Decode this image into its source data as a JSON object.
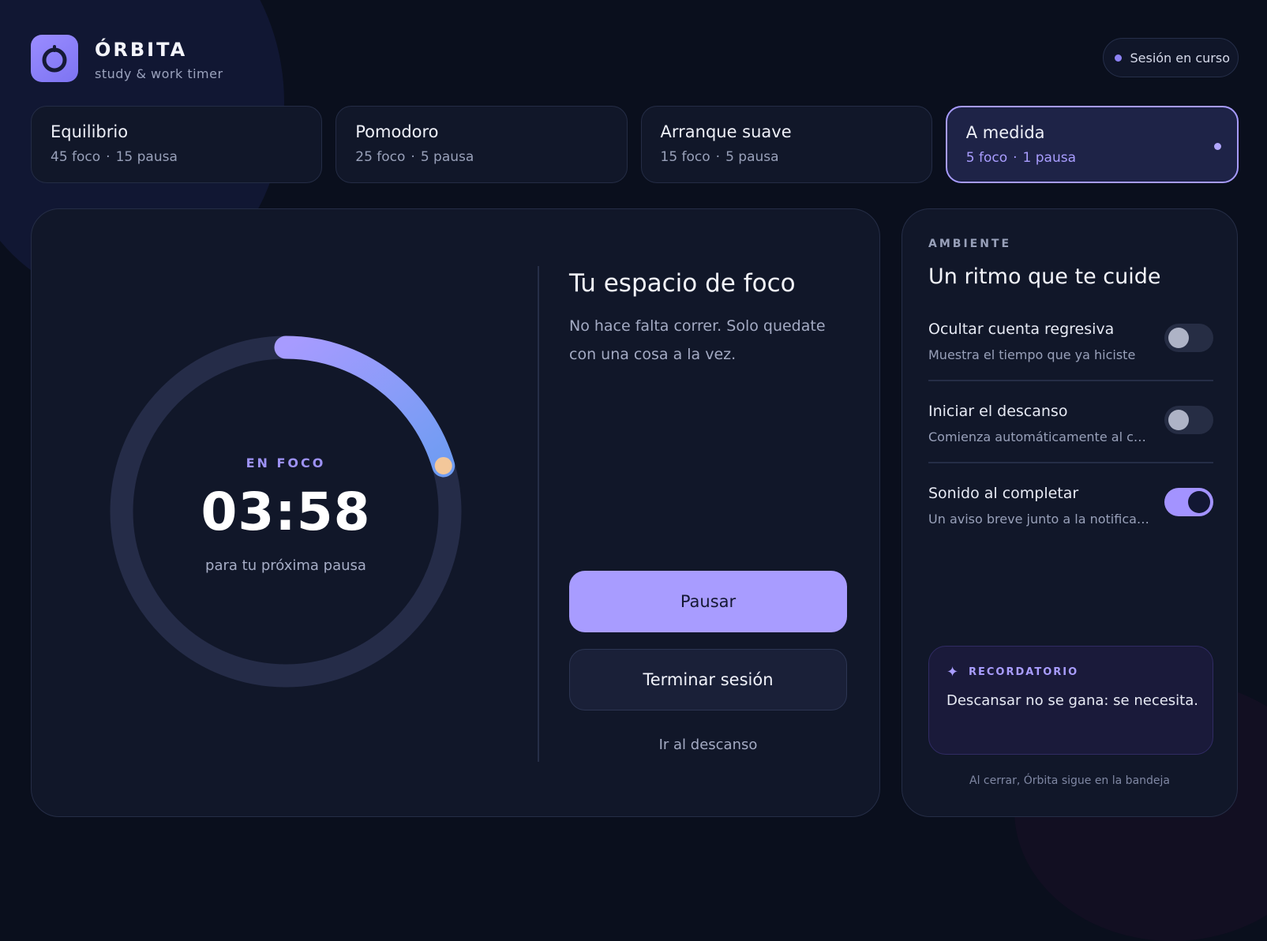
{
  "app": {
    "name": "ÓRBITA",
    "tagline": "study & work timer",
    "status": "Sesión en curso"
  },
  "presets": [
    {
      "name": "Equilibrio",
      "focus": "45 foco",
      "pause": "15 pausa",
      "separator": "·",
      "active": false
    },
    {
      "name": "Pomodoro",
      "focus": "25 foco",
      "pause": "5 pausa",
      "separator": "·",
      "active": false
    },
    {
      "name": "Arranque suave",
      "focus": "15 foco",
      "pause": "5 pausa",
      "separator": "·",
      "active": false
    },
    {
      "name": "A medida",
      "focus": "5 foco",
      "pause": "1 pausa",
      "separator": "·",
      "active": true
    }
  ],
  "timer": {
    "state_label": "EN FOCO",
    "time": "03:58",
    "caption": "para tu próxima pausa",
    "elapsed_fraction": 0.205
  },
  "focus_panel": {
    "title": "Tu espacio de foco",
    "description": "No hace falta correr. Solo quedate con una cosa a la vez.",
    "primary_button": "Pausar",
    "secondary_button": "Terminar sesión",
    "link": "Ir al descanso"
  },
  "sidebar": {
    "eyebrow": "AMBIENTE",
    "title": "Un ritmo que te cuide",
    "settings": [
      {
        "title": "Ocultar cuenta regresiva",
        "description": "Muestra el tiempo que ya hiciste",
        "enabled": false
      },
      {
        "title": "Iniciar el descanso",
        "description": "Comienza automáticamente al co...",
        "enabled": false
      },
      {
        "title": "Sonido al completar",
        "description": "Un aviso breve junto a la notificaci...",
        "enabled": true
      }
    ],
    "reminder": {
      "icon": "sparkle-icon",
      "label": "RECORDATORIO",
      "text": "Descansar no se gana: se necesita."
    },
    "footer": "Al cerrar, Órbita sigue en la bandeja"
  },
  "colors": {
    "background": "#0a0f1d",
    "card": "#111729",
    "accent": "#a89cff",
    "ring_track": "#252c48",
    "ring_progress_start": "#a79bff",
    "ring_progress_end": "#6f9cf2",
    "ring_knob": "#f3c79a"
  }
}
